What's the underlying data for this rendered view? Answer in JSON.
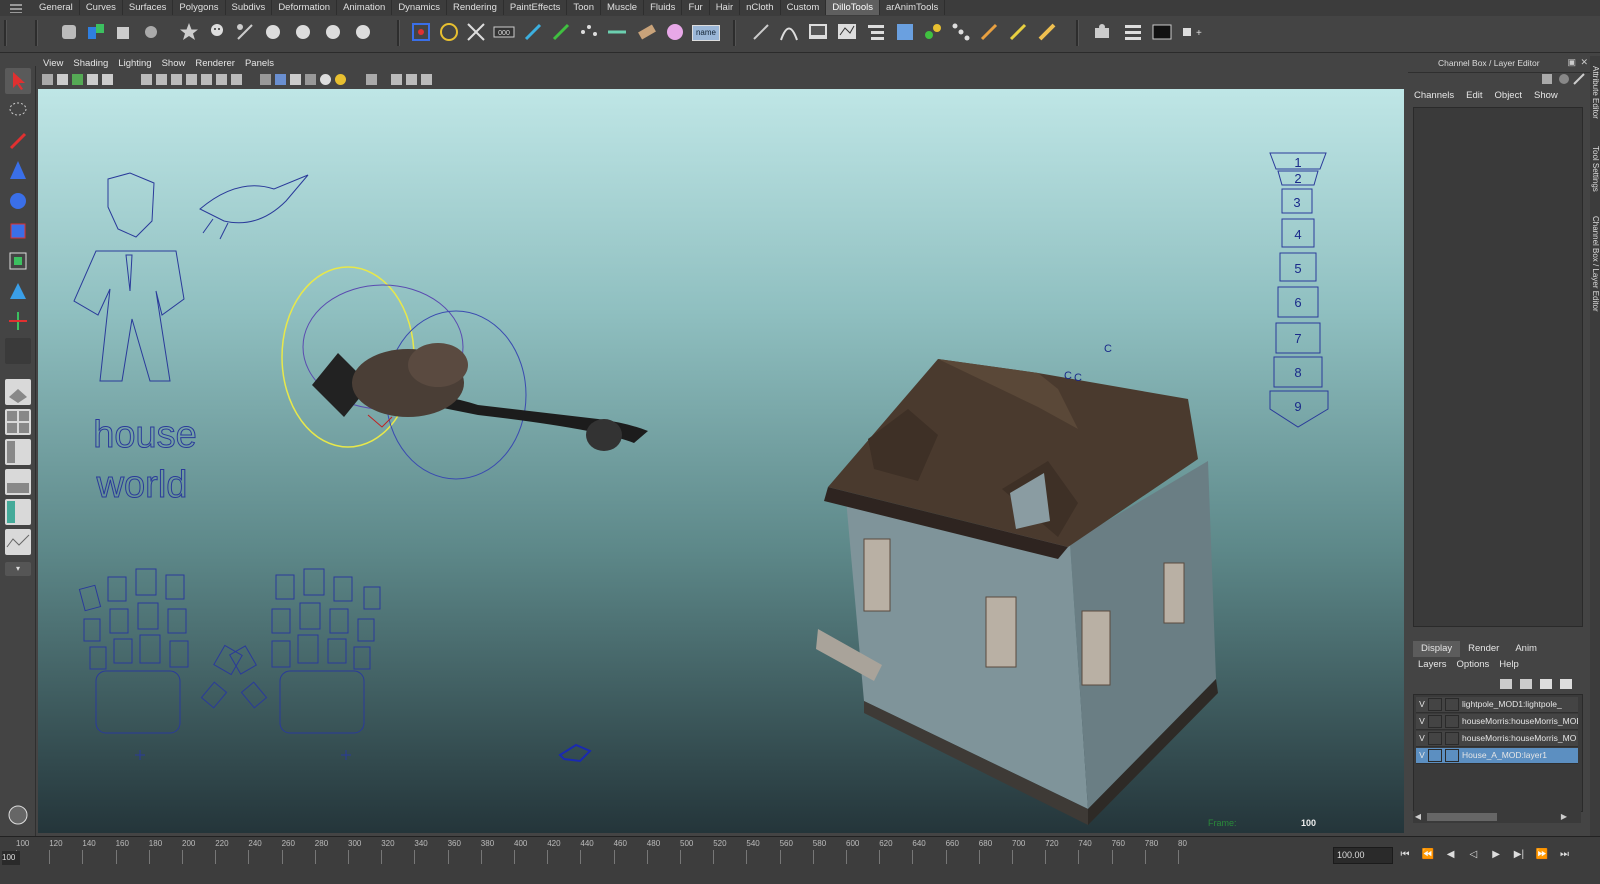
{
  "shelf_tabs": [
    "General",
    "Curves",
    "Surfaces",
    "Polygons",
    "Subdivs",
    "Deformation",
    "Animation",
    "Dynamics",
    "Rendering",
    "PaintEffects",
    "Toon",
    "Muscle",
    "Fluids",
    "Fur",
    "Hair",
    "nCloth",
    "Custom",
    "DilloTools",
    "arAnimTools"
  ],
  "active_shelf_tab": "DilloTools",
  "shelf_name_button": "name",
  "viewport_menu": [
    "View",
    "Shading",
    "Lighting",
    "Show",
    "Renderer",
    "Panels"
  ],
  "viewport": {
    "house_label_line1": "house",
    "house_label_line2": "world",
    "selector_numbers": [
      "1",
      "2",
      "3",
      "4",
      "5",
      "6",
      "7",
      "8",
      "9"
    ],
    "frame_label": "Frame:",
    "frame_value": "100",
    "c_markers": [
      "C",
      "C",
      "C"
    ]
  },
  "timeline": {
    "ticks": [
      "100",
      "120",
      "140",
      "160",
      "180",
      "200",
      "220",
      "240",
      "260",
      "280",
      "300",
      "320",
      "340",
      "360",
      "380",
      "400",
      "420",
      "440",
      "460",
      "480",
      "500",
      "520",
      "540",
      "560",
      "580",
      "600",
      "620",
      "640",
      "660",
      "680",
      "700",
      "720",
      "740",
      "760",
      "780",
      "80"
    ],
    "current_frame": "100",
    "range_value": "100.00",
    "playback": [
      "⏮",
      "⏭",
      "◁",
      "▶",
      "⏩",
      "⏭"
    ]
  },
  "right_panel": {
    "title": "Channel Box / Layer Editor",
    "menu": [
      "Channels",
      "Edit",
      "Object",
      "Show"
    ],
    "tabs": [
      "Display",
      "Render",
      "Anim"
    ],
    "active_tab": "Display",
    "layer_menu": [
      "Layers",
      "Options",
      "Help"
    ],
    "layers": [
      {
        "visible": "V",
        "name": "lightpole_MOD1:lightpole_"
      },
      {
        "visible": "V",
        "name": "houseMorris:houseMorris_MOD"
      },
      {
        "visible": "V",
        "name": "houseMorris:houseMorris_MO"
      },
      {
        "visible": "V",
        "name": "House_A_MOD:layer1"
      }
    ],
    "side_tabs": [
      "Attribute Editor",
      "Tool Settings",
      "Channel Box / Layer Editor"
    ]
  },
  "colors": {
    "selected_layer": "#5c8fc1",
    "active_tab": "#5f5f5f",
    "wire_blue": "#2a3a9a",
    "yellow_ring": "#e8e84a"
  }
}
